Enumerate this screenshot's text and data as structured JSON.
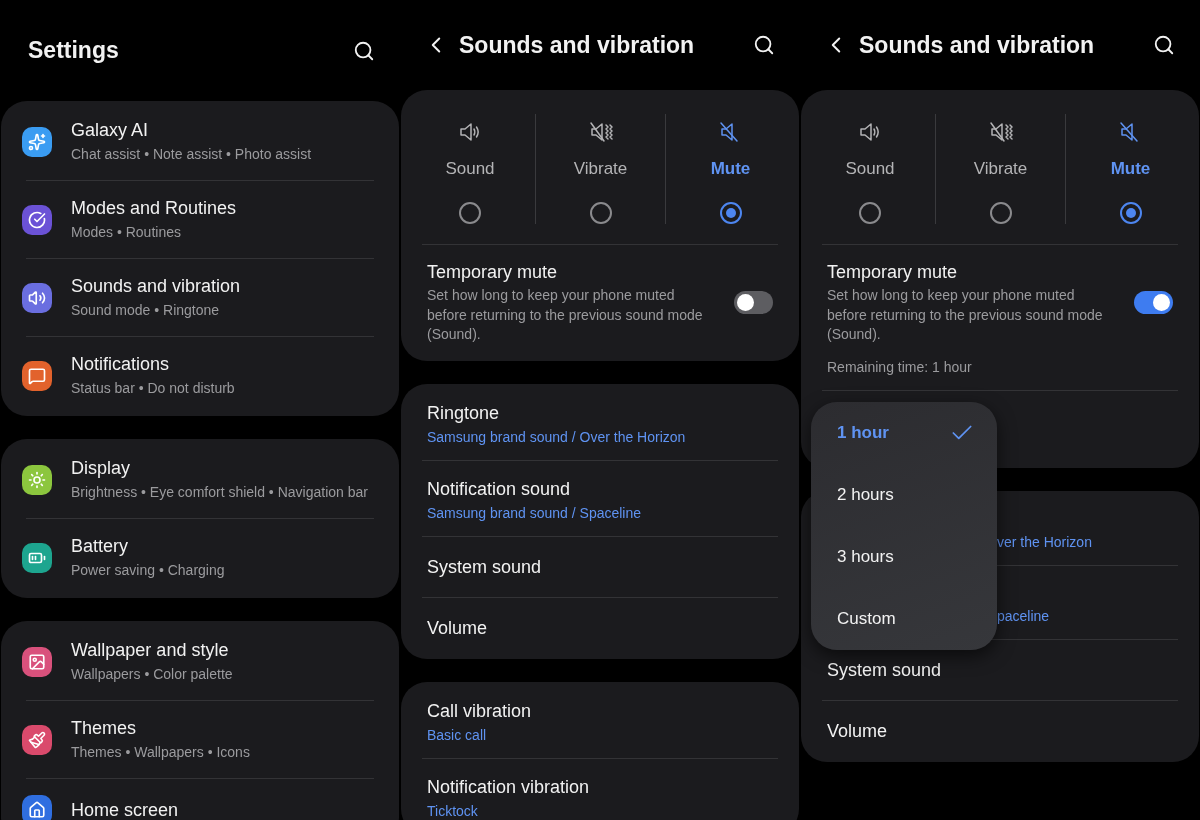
{
  "panels": [
    {
      "kind": "settings",
      "title": "Settings",
      "groups": [
        [
          {
            "title": "Galaxy AI",
            "subtitle": "Chat assist • Note assist • Photo assist",
            "color": "#3a9cf2"
          },
          {
            "title": "Modes and Routines",
            "subtitle": "Modes • Routines",
            "color": "#6b52d6"
          },
          {
            "title": "Sounds and vibration",
            "subtitle": "Sound mode • Ringtone",
            "color": "#6a6ee0"
          },
          {
            "title": "Notifications",
            "subtitle": "Status bar • Do not disturb",
            "color": "#e2622c"
          }
        ],
        [
          {
            "title": "Display",
            "subtitle": "Brightness • Eye comfort shield • Navigation bar",
            "color": "#8cc63e"
          },
          {
            "title": "Battery",
            "subtitle": "Power saving • Charging",
            "color": "#1da58f"
          }
        ],
        [
          {
            "title": "Wallpaper and style",
            "subtitle": "Wallpapers • Color palette",
            "color": "#d9517c"
          },
          {
            "title": "Themes",
            "subtitle": "Themes • Wallpapers • Icons",
            "color": "#da4a6c"
          },
          {
            "title": "Home screen",
            "color": "#2f6ee0"
          }
        ]
      ]
    },
    {
      "kind": "sounds",
      "title": "Sounds and vibration",
      "modes": [
        {
          "label": "Sound",
          "selected": false
        },
        {
          "label": "Vibrate",
          "selected": false
        },
        {
          "label": "Mute",
          "selected": true
        }
      ],
      "temporary_mute": {
        "title": "Temporary mute",
        "description": "Set how long to keep your phone muted before returning to the previous sound mode (Sound).",
        "on": false
      },
      "groups": [
        [
          {
            "title": "Ringtone",
            "subtitle": "Samsung brand sound / Over the Horizon"
          },
          {
            "title": "Notification sound",
            "subtitle": "Samsung brand sound / Spaceline"
          },
          {
            "title": "System sound"
          },
          {
            "title": "Volume"
          }
        ],
        [
          {
            "title": "Call vibration",
            "subtitle": "Basic call"
          },
          {
            "title": "Notification vibration",
            "subtitle": "Ticktock"
          }
        ]
      ]
    },
    {
      "kind": "sounds",
      "title": "Sounds and vibration",
      "modes": [
        {
          "label": "Sound",
          "selected": false
        },
        {
          "label": "Vibrate",
          "selected": false
        },
        {
          "label": "Mute",
          "selected": true
        }
      ],
      "temporary_mute": {
        "title": "Temporary mute",
        "description": "Set how long to keep your phone muted before returning to the previous sound mode (Sound).",
        "on": true,
        "remaining": "Remaining time: 1 hour"
      },
      "dropdown": [
        {
          "label": "1 hour",
          "selected": true
        },
        {
          "label": "2 hours",
          "selected": false
        },
        {
          "label": "3 hours",
          "selected": false
        },
        {
          "label": "Custom",
          "selected": false
        }
      ],
      "groups": [
        [
          {
            "subtitle": "ver the Horizon"
          },
          {
            "subtitle": "paceline"
          },
          {
            "title": "System sound"
          },
          {
            "title": "Volume"
          }
        ]
      ]
    }
  ]
}
